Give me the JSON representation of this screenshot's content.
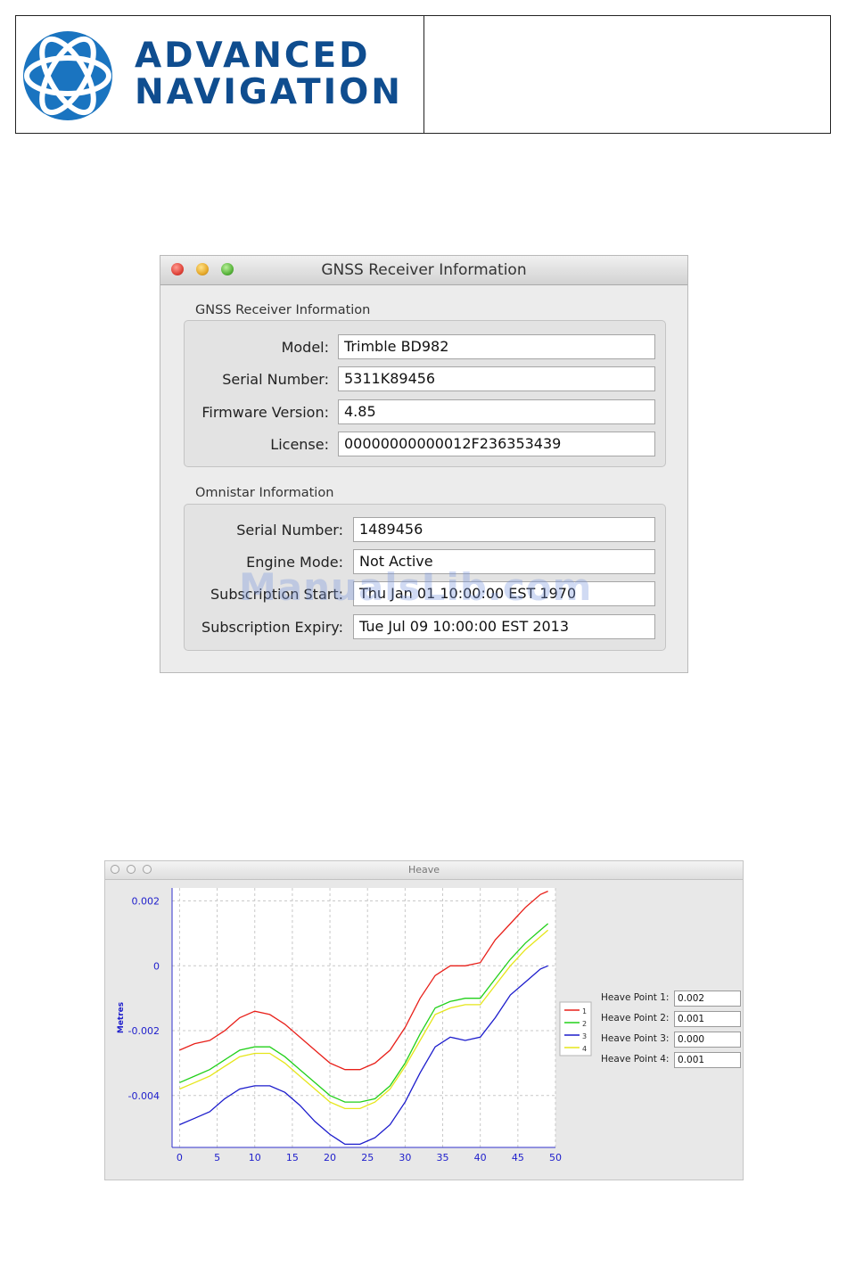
{
  "header": {
    "brand_line1": "ADVANCED",
    "brand_line2": "NAVIGATION",
    "brand_color": "#0f4d8f"
  },
  "gnss_window": {
    "title": "GNSS Receiver Information",
    "receiver_group": {
      "label": "GNSS Receiver Information",
      "fields": [
        {
          "label": "Model:",
          "value": "Trimble BD982"
        },
        {
          "label": "Serial Number:",
          "value": "5311K89456"
        },
        {
          "label": "Firmware Version:",
          "value": "4.85"
        },
        {
          "label": "License:",
          "value": "00000000000012F236353439"
        }
      ]
    },
    "omnistar_group": {
      "label": "Omnistar Information",
      "fields": [
        {
          "label": "Serial Number:",
          "value": "1489456"
        },
        {
          "label": "Engine Mode:",
          "value": "Not Active"
        },
        {
          "label": "Subscription Start:",
          "value": "Thu Jan 01 10:00:00 EST 1970"
        },
        {
          "label": "Subscription Expiry:",
          "value": "Tue Jul 09 10:00:00 EST 2013"
        }
      ]
    }
  },
  "watermark": "ManualsLib.com",
  "heave_window": {
    "title": "Heave",
    "heave_points": [
      {
        "label": "Heave Point 1:",
        "value": "0.002"
      },
      {
        "label": "Heave Point 2:",
        "value": "0.001"
      },
      {
        "label": "Heave Point 3:",
        "value": "0.000"
      },
      {
        "label": "Heave Point 4:",
        "value": "0.001"
      }
    ]
  },
  "chart_data": {
    "type": "line",
    "title": "",
    "xlabel": "",
    "ylabel": "Metres",
    "xlim": [
      -1,
      50
    ],
    "ylim": [
      -0.0056,
      0.0024
    ],
    "x_ticks": [
      0,
      5,
      10,
      15,
      20,
      25,
      30,
      35,
      40,
      45,
      50
    ],
    "y_ticks": [
      0.002,
      0,
      -0.002,
      -0.004
    ],
    "y_tick_labels": [
      "0.002",
      "0",
      "-0.002",
      "-0.004"
    ],
    "grid": true,
    "legend_placement": "right",
    "x": [
      0,
      2,
      4,
      6,
      8,
      10,
      12,
      14,
      16,
      18,
      20,
      22,
      24,
      26,
      28,
      30,
      32,
      34,
      36,
      38,
      40,
      42,
      44,
      46,
      48,
      49
    ],
    "series": [
      {
        "name": "1",
        "color": "#e8201a",
        "values": [
          -0.0026,
          -0.0024,
          -0.0023,
          -0.002,
          -0.0016,
          -0.0014,
          -0.0015,
          -0.0018,
          -0.0022,
          -0.0026,
          -0.003,
          -0.0032,
          -0.0032,
          -0.003,
          -0.0026,
          -0.0019,
          -0.001,
          -0.0003,
          0.0,
          0.0,
          0.0001,
          0.0008,
          0.0013,
          0.0018,
          0.0022,
          0.0023
        ]
      },
      {
        "name": "2",
        "color": "#22d01a",
        "values": [
          -0.0036,
          -0.0034,
          -0.0032,
          -0.0029,
          -0.0026,
          -0.0025,
          -0.0025,
          -0.0028,
          -0.0032,
          -0.0036,
          -0.004,
          -0.0042,
          -0.0042,
          -0.0041,
          -0.0037,
          -0.003,
          -0.0021,
          -0.0013,
          -0.0011,
          -0.001,
          -0.001,
          -0.0004,
          0.0002,
          0.0007,
          0.0011,
          0.0013
        ]
      },
      {
        "name": "3",
        "color": "#1c1ccc",
        "values": [
          -0.0049,
          -0.0047,
          -0.0045,
          -0.0041,
          -0.0038,
          -0.0037,
          -0.0037,
          -0.0039,
          -0.0043,
          -0.0048,
          -0.0052,
          -0.0055,
          -0.0055,
          -0.0053,
          -0.0049,
          -0.0042,
          -0.0033,
          -0.0025,
          -0.0022,
          -0.0023,
          -0.0022,
          -0.0016,
          -0.0009,
          -0.0005,
          -0.0001,
          0.0
        ]
      },
      {
        "name": "4",
        "color": "#e6e61a",
        "values": [
          -0.0038,
          -0.0036,
          -0.0034,
          -0.0031,
          -0.0028,
          -0.0027,
          -0.0027,
          -0.003,
          -0.0034,
          -0.0038,
          -0.0042,
          -0.0044,
          -0.0044,
          -0.0042,
          -0.0038,
          -0.0031,
          -0.0023,
          -0.0015,
          -0.0013,
          -0.0012,
          -0.0012,
          -0.0006,
          0.0,
          0.0005,
          0.0009,
          0.0011
        ]
      }
    ]
  }
}
